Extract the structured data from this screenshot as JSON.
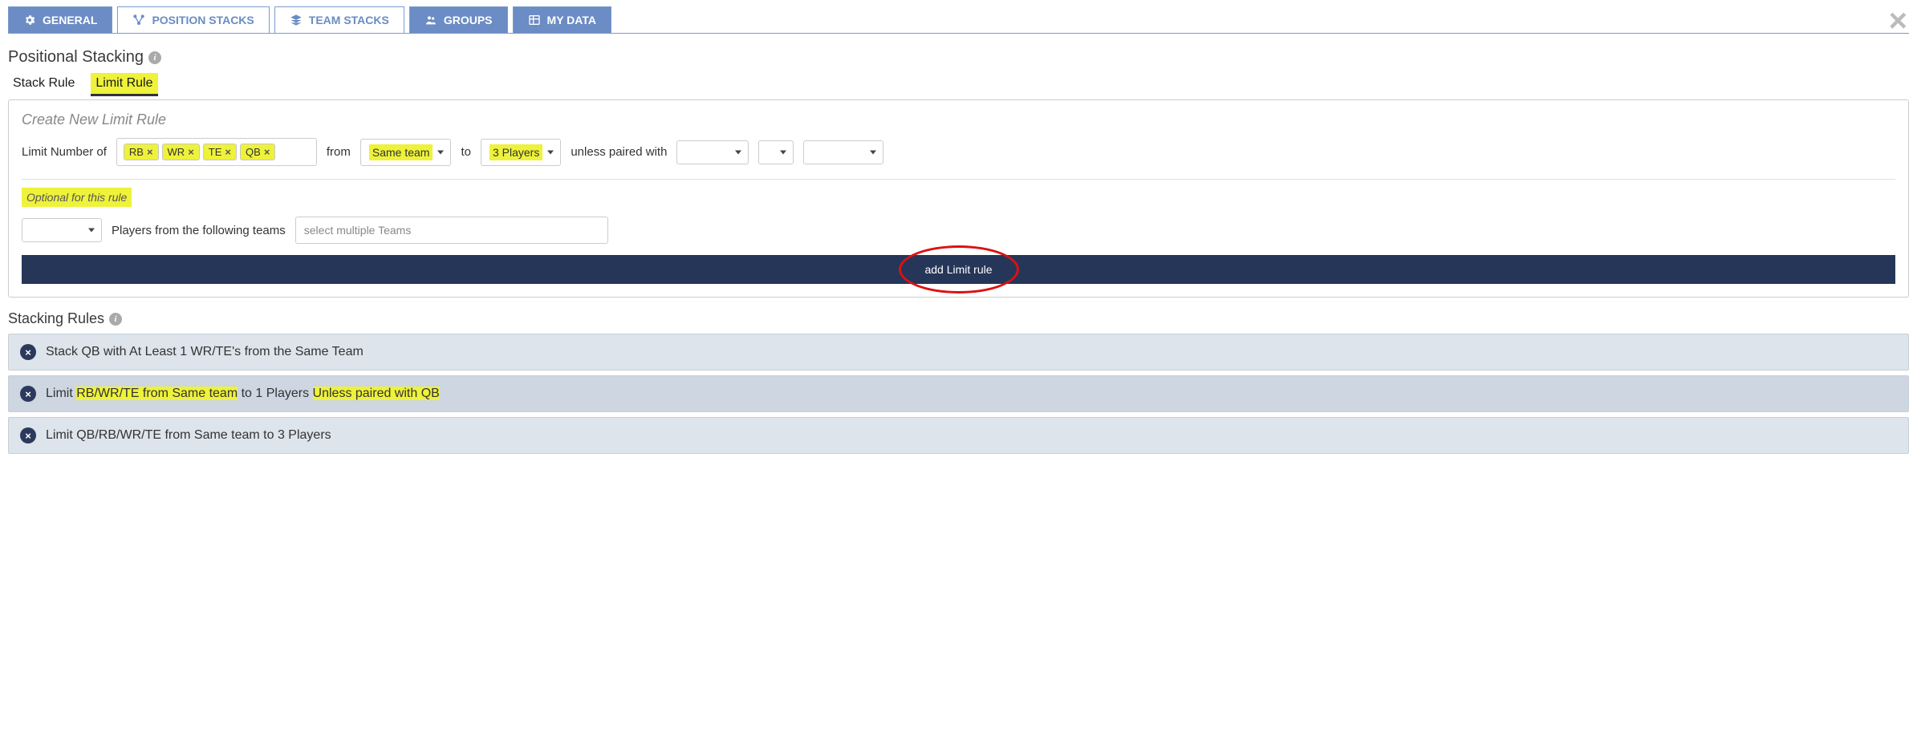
{
  "tabs": {
    "general": "GENERAL",
    "position_stacks": "POSITION STACKS",
    "team_stacks": "TEAM STACKS",
    "groups": "GROUPS",
    "my_data": "MY DATA"
  },
  "section_title": "Positional Stacking",
  "subtabs": {
    "stack_rule": "Stack Rule",
    "limit_rule": "Limit Rule"
  },
  "panel": {
    "heading": "Create New Limit Rule",
    "limit_label": "Limit Number of",
    "tokens": [
      "RB",
      "WR",
      "TE",
      "QB"
    ],
    "from_label": "from",
    "from_dd": "Same team",
    "to_label": "to",
    "to_dd": "3 Players",
    "unless_label": "unless paired with",
    "optional_note": "Optional for this rule",
    "players_from_label": "Players from the following teams",
    "teams_placeholder": "select multiple Teams",
    "add_btn": "add Limit rule"
  },
  "rules_title": "Stacking Rules",
  "rules": [
    "Stack QB with At Least 1 WR/TE's from the Same Team",
    {
      "pre": "Limit ",
      "h1": "RB/WR/TE from Same team",
      "mid": " to 1 Players ",
      "h2": "Unless paired with QB"
    },
    "Limit QB/RB/WR/TE from Same team to 3 Players"
  ]
}
